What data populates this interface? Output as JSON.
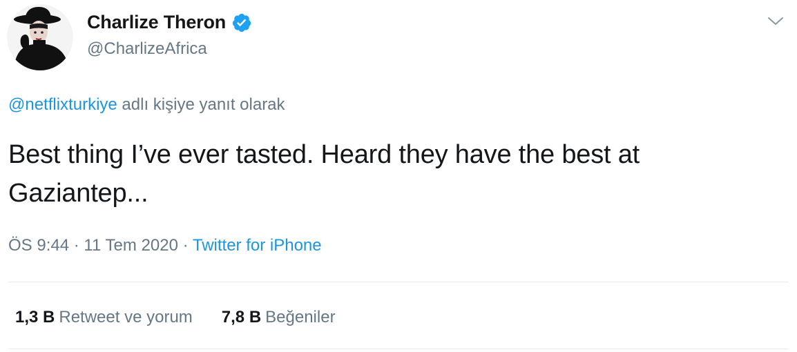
{
  "author": {
    "name": "Charlize Theron",
    "handle": "@CharlizeAfrica",
    "verified_icon": "verified-badge-icon",
    "avatar_icon": "profile-avatar"
  },
  "reply": {
    "mention": "@netflixturkiye",
    "suffix": "adlı kişiye yanıt olarak"
  },
  "tweet": {
    "text": "Best thing I’ve ever tasted. Heard they have the best at Gaziantep..."
  },
  "meta": {
    "time": "ÖS 9:44",
    "separator": "·",
    "date": "11 Tem 2020",
    "source": "Twitter for iPhone"
  },
  "stats": {
    "retweets_count": "1,3 B",
    "retweets_label": "Retweet ve yorum",
    "likes_count": "7,8 B",
    "likes_label": "Beğeniler"
  },
  "colors": {
    "link": "#1b95e0",
    "secondary_text": "#657786",
    "verified": "#1da1f2"
  }
}
